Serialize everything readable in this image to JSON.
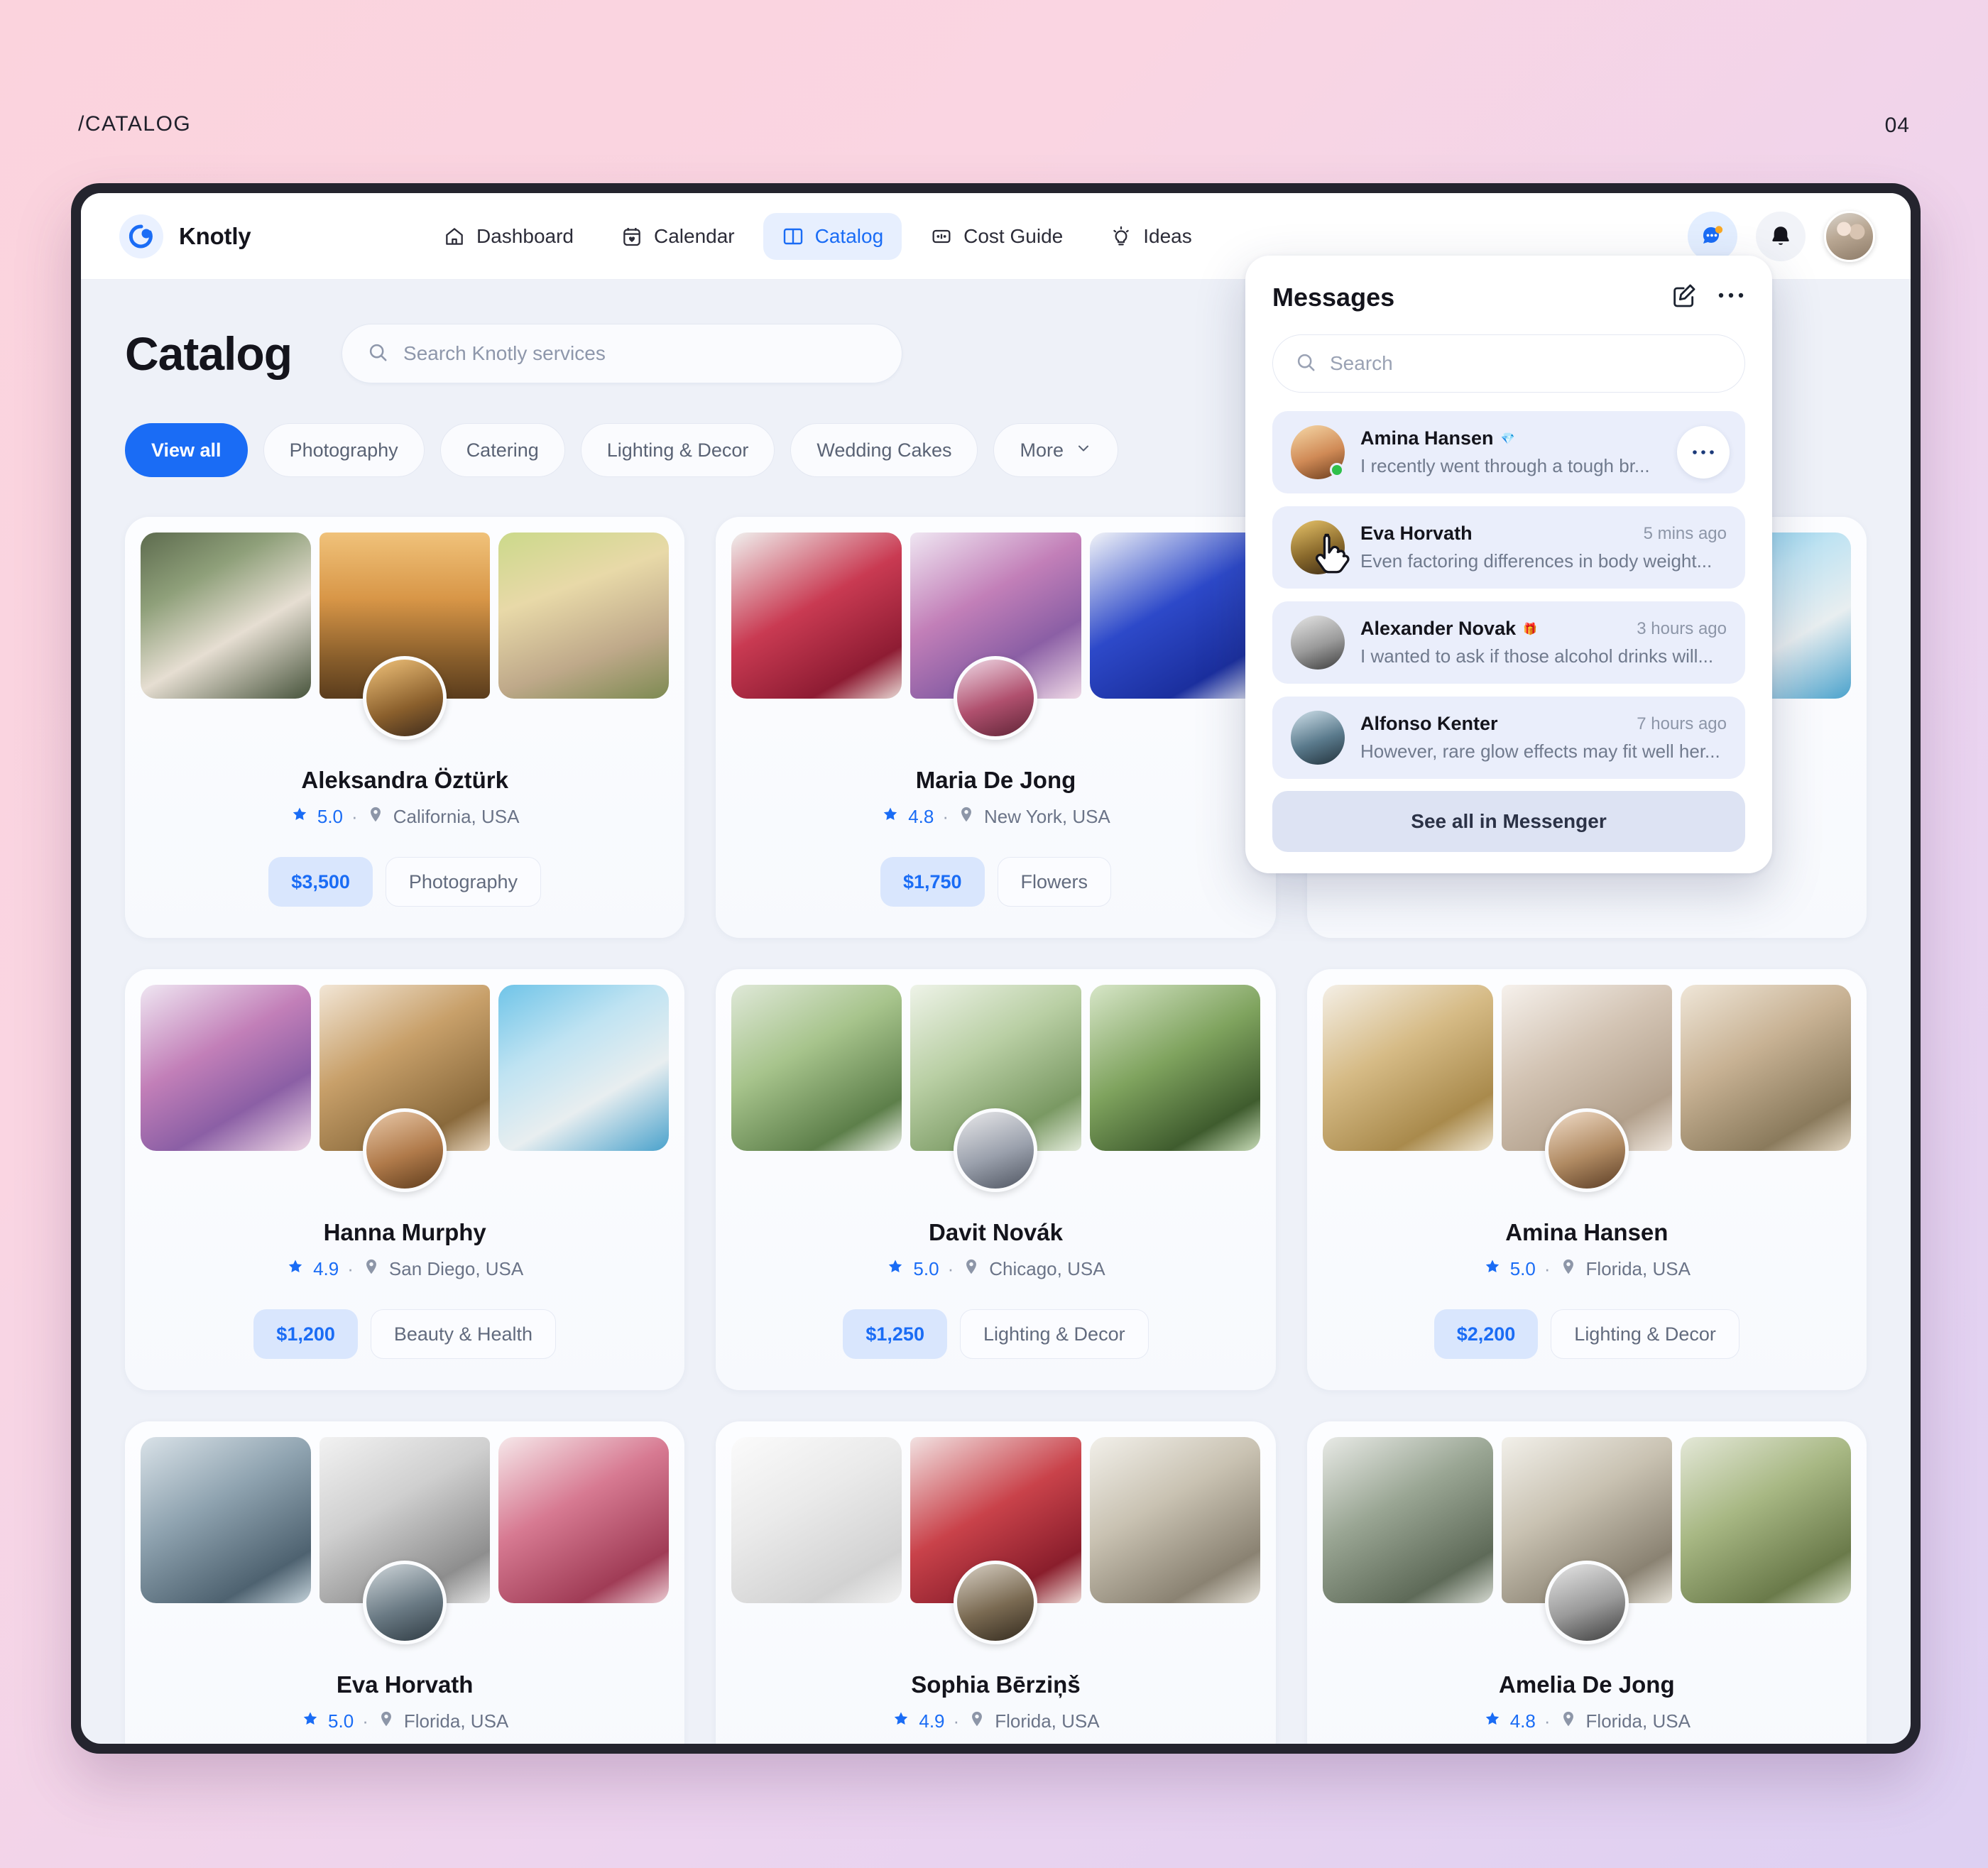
{
  "slide": {
    "label": "/CATALOG",
    "page_number": "04"
  },
  "app": {
    "brand": "Knotly",
    "nav": [
      {
        "label": "Dashboard",
        "icon": "home-icon",
        "active": false
      },
      {
        "label": "Calendar",
        "icon": "calendar-heart-icon",
        "active": false
      },
      {
        "label": "Catalog",
        "icon": "book-open-icon",
        "active": true
      },
      {
        "label": "Cost Guide",
        "icon": "calculator-icon",
        "active": false
      },
      {
        "label": "Ideas",
        "icon": "lightbulb-icon",
        "active": false
      }
    ],
    "top_actions": {
      "messages_icon": "chat-bubble-icon",
      "notifications_icon": "bell-icon",
      "avatar": "user-avatar"
    }
  },
  "page": {
    "title": "Catalog",
    "search_placeholder": "Search Knotly services",
    "search_value": "",
    "filters": [
      {
        "label": "View all",
        "active": true
      },
      {
        "label": "Photography",
        "active": false
      },
      {
        "label": "Catering",
        "active": false
      },
      {
        "label": "Lighting & Decor",
        "active": false
      },
      {
        "label": "Wedding Cakes",
        "active": false
      },
      {
        "label": "More",
        "active": false,
        "has_chevron": true
      }
    ]
  },
  "cards": [
    {
      "name": "Aleksandra Öztürk",
      "rating": "5.0",
      "location": "California, USA",
      "price": "$3,500",
      "category": "Photography"
    },
    {
      "name": "Maria De Jong",
      "rating": "4.8",
      "location": "New York, USA",
      "price": "$1,750",
      "category": "Flowers"
    },
    {
      "name": "",
      "rating": "",
      "location": "",
      "price": "",
      "category": ""
    },
    {
      "name": "Hanna Murphy",
      "rating": "4.9",
      "location": "San Diego, USA",
      "price": "$1,200",
      "category": "Beauty & Health"
    },
    {
      "name": "Davit Novák",
      "rating": "5.0",
      "location": "Chicago, USA",
      "price": "$1,250",
      "category": "Lighting & Decor"
    },
    {
      "name": "Amina Hansen",
      "rating": "5.0",
      "location": "Florida, USA",
      "price": "$2,200",
      "category": "Lighting & Decor"
    },
    {
      "name": "Eva Horvath",
      "rating": "5.0",
      "location": "Florida, USA",
      "price": "",
      "category": ""
    },
    {
      "name": "Sophia Bērziņš",
      "rating": "4.9",
      "location": "Florida, USA",
      "price": "",
      "category": ""
    },
    {
      "name": "Amelia De Jong",
      "rating": "4.8",
      "location": "Florida, USA",
      "price": "",
      "category": ""
    }
  ],
  "messages_panel": {
    "title": "Messages",
    "compose_icon": "compose-pencil-icon",
    "more_icon": "ellipsis-icon",
    "search_placeholder": "Search",
    "search_value": "",
    "footer_button": "See all in Messenger",
    "threads": [
      {
        "name": "Amina Hansen",
        "badge": "💎",
        "time": "",
        "preview": "I recently went through a tough br...",
        "online": true,
        "selected": true
      },
      {
        "name": "Eva Horvath",
        "badge": "",
        "time": "5 mins ago",
        "preview": "Even factoring differences in body weight...",
        "online": true,
        "selected": false
      },
      {
        "name": "Alexander Novak",
        "badge": "🎁",
        "time": "3 hours ago",
        "preview": "I wanted to ask if those alcohol drinks will...",
        "online": false,
        "selected": false
      },
      {
        "name": "Alfonso Kenter",
        "badge": "",
        "time": "7 hours ago",
        "preview": "However, rare glow effects may fit well her...",
        "online": false,
        "selected": false
      }
    ]
  },
  "colors": {
    "accent": "#1a6cf5",
    "accent_soft": "#d9e6fd",
    "app_bg": "#eef1f8",
    "card_bg": "#fbfcfe",
    "thread_bg": "#eaeefb",
    "text_dark": "#14141c",
    "text_muted": "#6b7488",
    "online": "#2ec04a"
  }
}
